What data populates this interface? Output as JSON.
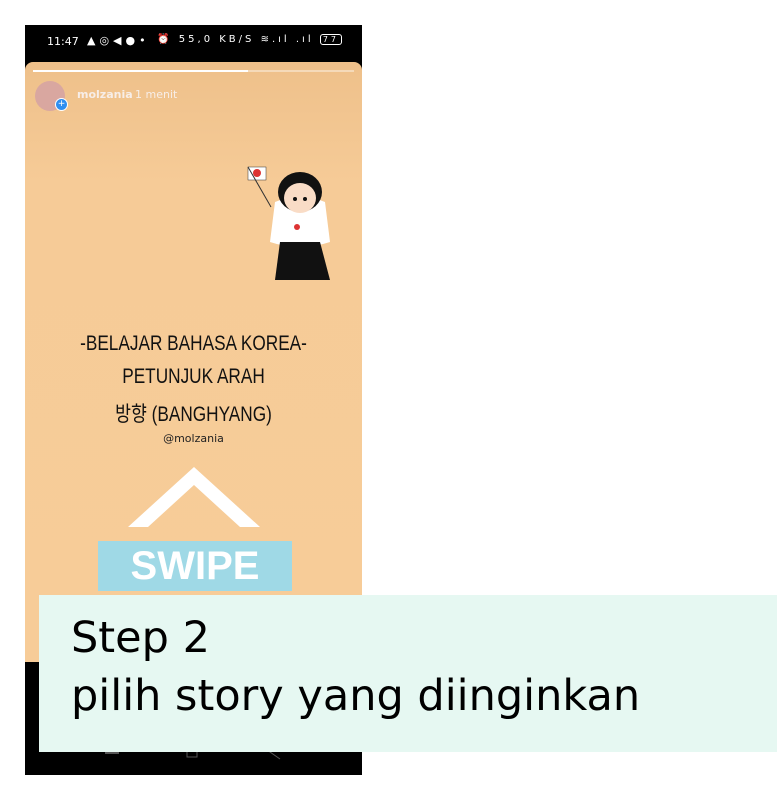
{
  "status_bar": {
    "time": "11:47",
    "notification_icons": [
      "alert-icon",
      "whatsapp-icon",
      "telegram-icon",
      "phone-icon",
      "dot-icon"
    ],
    "speed": "55,0 KB/S",
    "battery": "77"
  },
  "story": {
    "progress": 0.67,
    "username": "molzania",
    "time_ago": "1 menit",
    "title_line1": "-BELAJAR BAHASA KOREA-",
    "title_line2": "PETUNJUK ARAH",
    "title_line3": "방향 (BANGHYANG)",
    "handle": "@molzania",
    "swipe_label": "SWIPE UP",
    "bg_color": "#f6cb97",
    "swipe_color": "#9fd9e6"
  },
  "caption": {
    "line1": "Step 2",
    "line2": "pilih story yang diinginkan",
    "bg_color": "#e6f8f2"
  }
}
